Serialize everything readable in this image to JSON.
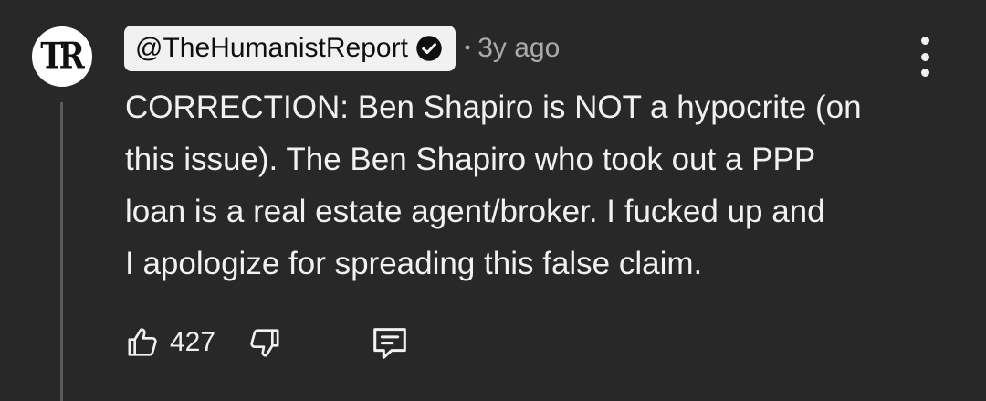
{
  "comment": {
    "author": {
      "avatar_text": "TR",
      "handle": "@TheHumanistReport",
      "verified": true
    },
    "separator": "•",
    "timestamp": "3y ago",
    "text": "CORRECTION: Ben Shapiro is NOT a hypocrite (on\nthis issue). The Ben Shapiro who took out a PPP\nloan is a real estate agent/broker. I fucked up and\nI apologize for spreading this false claim.",
    "likes": "427"
  },
  "icons": {
    "verified": "verified-check-icon",
    "more": "more-vertical-icon",
    "like": "thumbs-up-icon",
    "dislike": "thumbs-down-icon",
    "reply": "comment-icon"
  },
  "colors": {
    "background": "#282828",
    "text": "#f1f1f1",
    "meta": "#aaaaaa",
    "chip": "#f1f1f1"
  }
}
